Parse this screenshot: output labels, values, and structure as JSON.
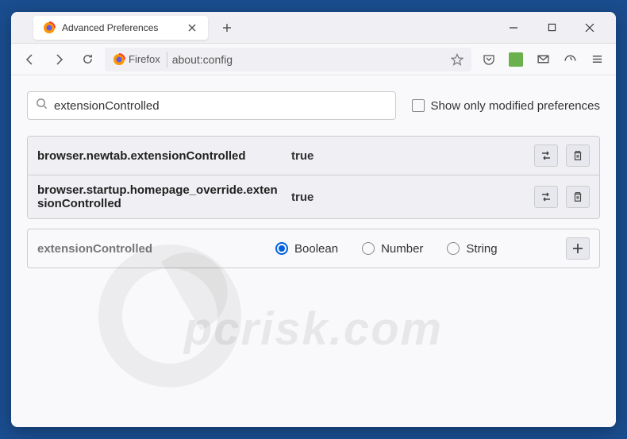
{
  "tab": {
    "title": "Advanced Preferences"
  },
  "url_bar": {
    "identity_label": "Firefox",
    "url": "about:config"
  },
  "search": {
    "value": "extensionControlled",
    "checkbox_label": "Show only modified preferences"
  },
  "prefs": [
    {
      "name": "browser.newtab.extensionControlled",
      "value": "true"
    },
    {
      "name": "browser.startup.homepage_override.extensionControlled",
      "value": "true"
    }
  ],
  "new_pref": {
    "name": "extensionControlled",
    "types": [
      {
        "label": "Boolean",
        "selected": true
      },
      {
        "label": "Number",
        "selected": false
      },
      {
        "label": "String",
        "selected": false
      }
    ]
  },
  "watermark": "pcrisk.com"
}
